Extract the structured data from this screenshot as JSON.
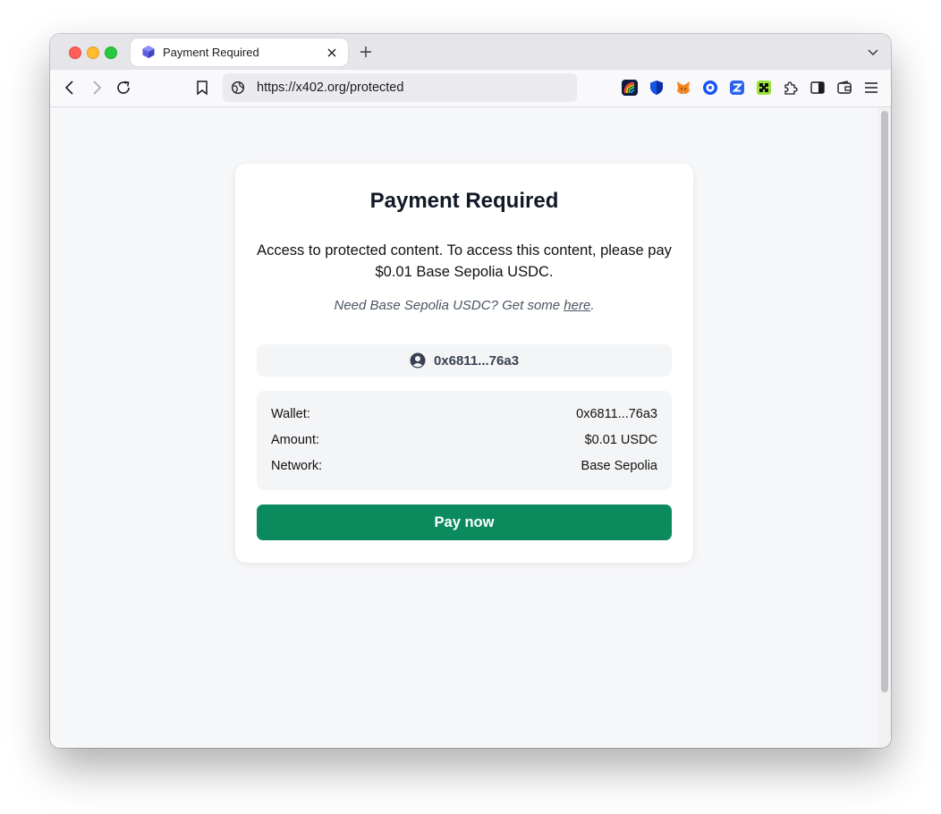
{
  "browser": {
    "tab": {
      "title": "Payment Required",
      "favicon": "cube-icon"
    },
    "url": "https://x402.org/protected",
    "toolbar_icons": [
      "back-icon",
      "forward-icon",
      "reload-icon",
      "bookmark-icon",
      "globe-icon"
    ],
    "extensions": [
      "rainbow-extension",
      "shield-extension",
      "metamask-extension",
      "coinbase-extension",
      "zerion-extension",
      "phantom-extension",
      "puzzle-icon",
      "sidebar-icon",
      "wallet-icon",
      "menu-icon"
    ]
  },
  "card": {
    "title": "Payment Required",
    "description": "Access to protected content. To access this content, please pay $0.01 Base Sepolia USDC.",
    "hint_prefix": "Need Base Sepolia USDC? Get some ",
    "hint_link": "here",
    "hint_suffix": ".",
    "wallet_address": "0x6811...76a3",
    "details": [
      {
        "label": "Wallet:",
        "value": "0x6811...76a3"
      },
      {
        "label": "Amount:",
        "value": "$0.01 USDC"
      },
      {
        "label": "Network:",
        "value": "Base Sepolia"
      }
    ],
    "pay_button": "Pay now"
  },
  "colors": {
    "accent": "#0b8a5e",
    "title": "#111827",
    "panel": "#f4f5f7",
    "page_bg": "#f6f7f9"
  }
}
